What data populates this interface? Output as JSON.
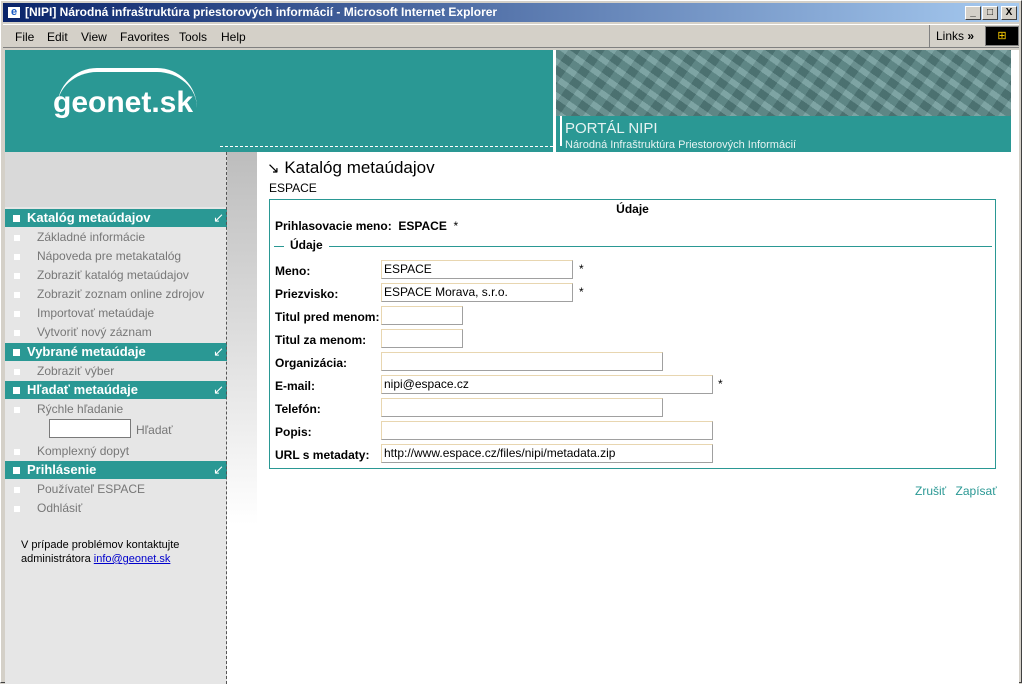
{
  "window": {
    "title": "[NIPI] Národná infraštruktúra priestorových informácií - Microsoft Internet Explorer",
    "minimize": "_",
    "maximize": "□",
    "close": "X"
  },
  "menu": [
    "File",
    "Edit",
    "View",
    "Favorites",
    "Tools",
    "Help"
  ],
  "links_label": "Links",
  "header": {
    "logo": "geonet.sk",
    "portal_title": "PORTÁL NIPI",
    "portal_subtitle": "Národná Infraštruktúra Priestorových Informácií"
  },
  "sidebar": {
    "sections": [
      {
        "title": "Katalóg metaúdajov",
        "items": [
          "Základné informácie",
          "Nápoveda pre metakatalóg",
          "Zobraziť katalóg metaúdajov",
          "Zobraziť zoznam online zdrojov",
          "Importovať metaúdaje",
          "Vytvoriť nový záznam"
        ]
      },
      {
        "title": "Vybrané metaúdaje",
        "items": [
          "Zobraziť výber"
        ]
      },
      {
        "title": "Hľadať metaúdaje",
        "items": [
          "Rýchle hľadanie",
          "Komplexný dopyt"
        ]
      },
      {
        "title": "Prihlásenie",
        "items": [
          "Používateľ ESPACE",
          "Odhlásiť"
        ]
      }
    ],
    "search_button": "Hľadať",
    "help_line1": "V prípade problémov kontaktujte",
    "help_line2": "administrátora",
    "help_email": "info@geonet.sk"
  },
  "main": {
    "title": "Katalóg metaúdajov",
    "title_arrow": "↘",
    "user": "ESPACE",
    "box_title": "Údaje",
    "login_label": "Prihlasovacie meno:",
    "login_value": "ESPACE",
    "required_mark": "*",
    "fieldset_legend": "Údaje",
    "fields": [
      {
        "label": "Meno:",
        "value": "ESPACE"
      },
      {
        "label": "Priezvisko:",
        "value": "ESPACE Morava, s.r.o."
      },
      {
        "label": "Titul pred menom:",
        "value": ""
      },
      {
        "label": "Titul za menom:",
        "value": ""
      },
      {
        "label": "Organizácia:",
        "value": ""
      },
      {
        "label": "E-mail:",
        "value": "nipi@espace.cz"
      },
      {
        "label": "Telefón:",
        "value": ""
      },
      {
        "label": "Popis:",
        "value": ""
      },
      {
        "label": "URL s metadaty:",
        "value": "http://www.espace.cz/files/nipi/metadata.zip"
      }
    ],
    "cancel": "Zrušiť",
    "save": "Zapísať"
  }
}
